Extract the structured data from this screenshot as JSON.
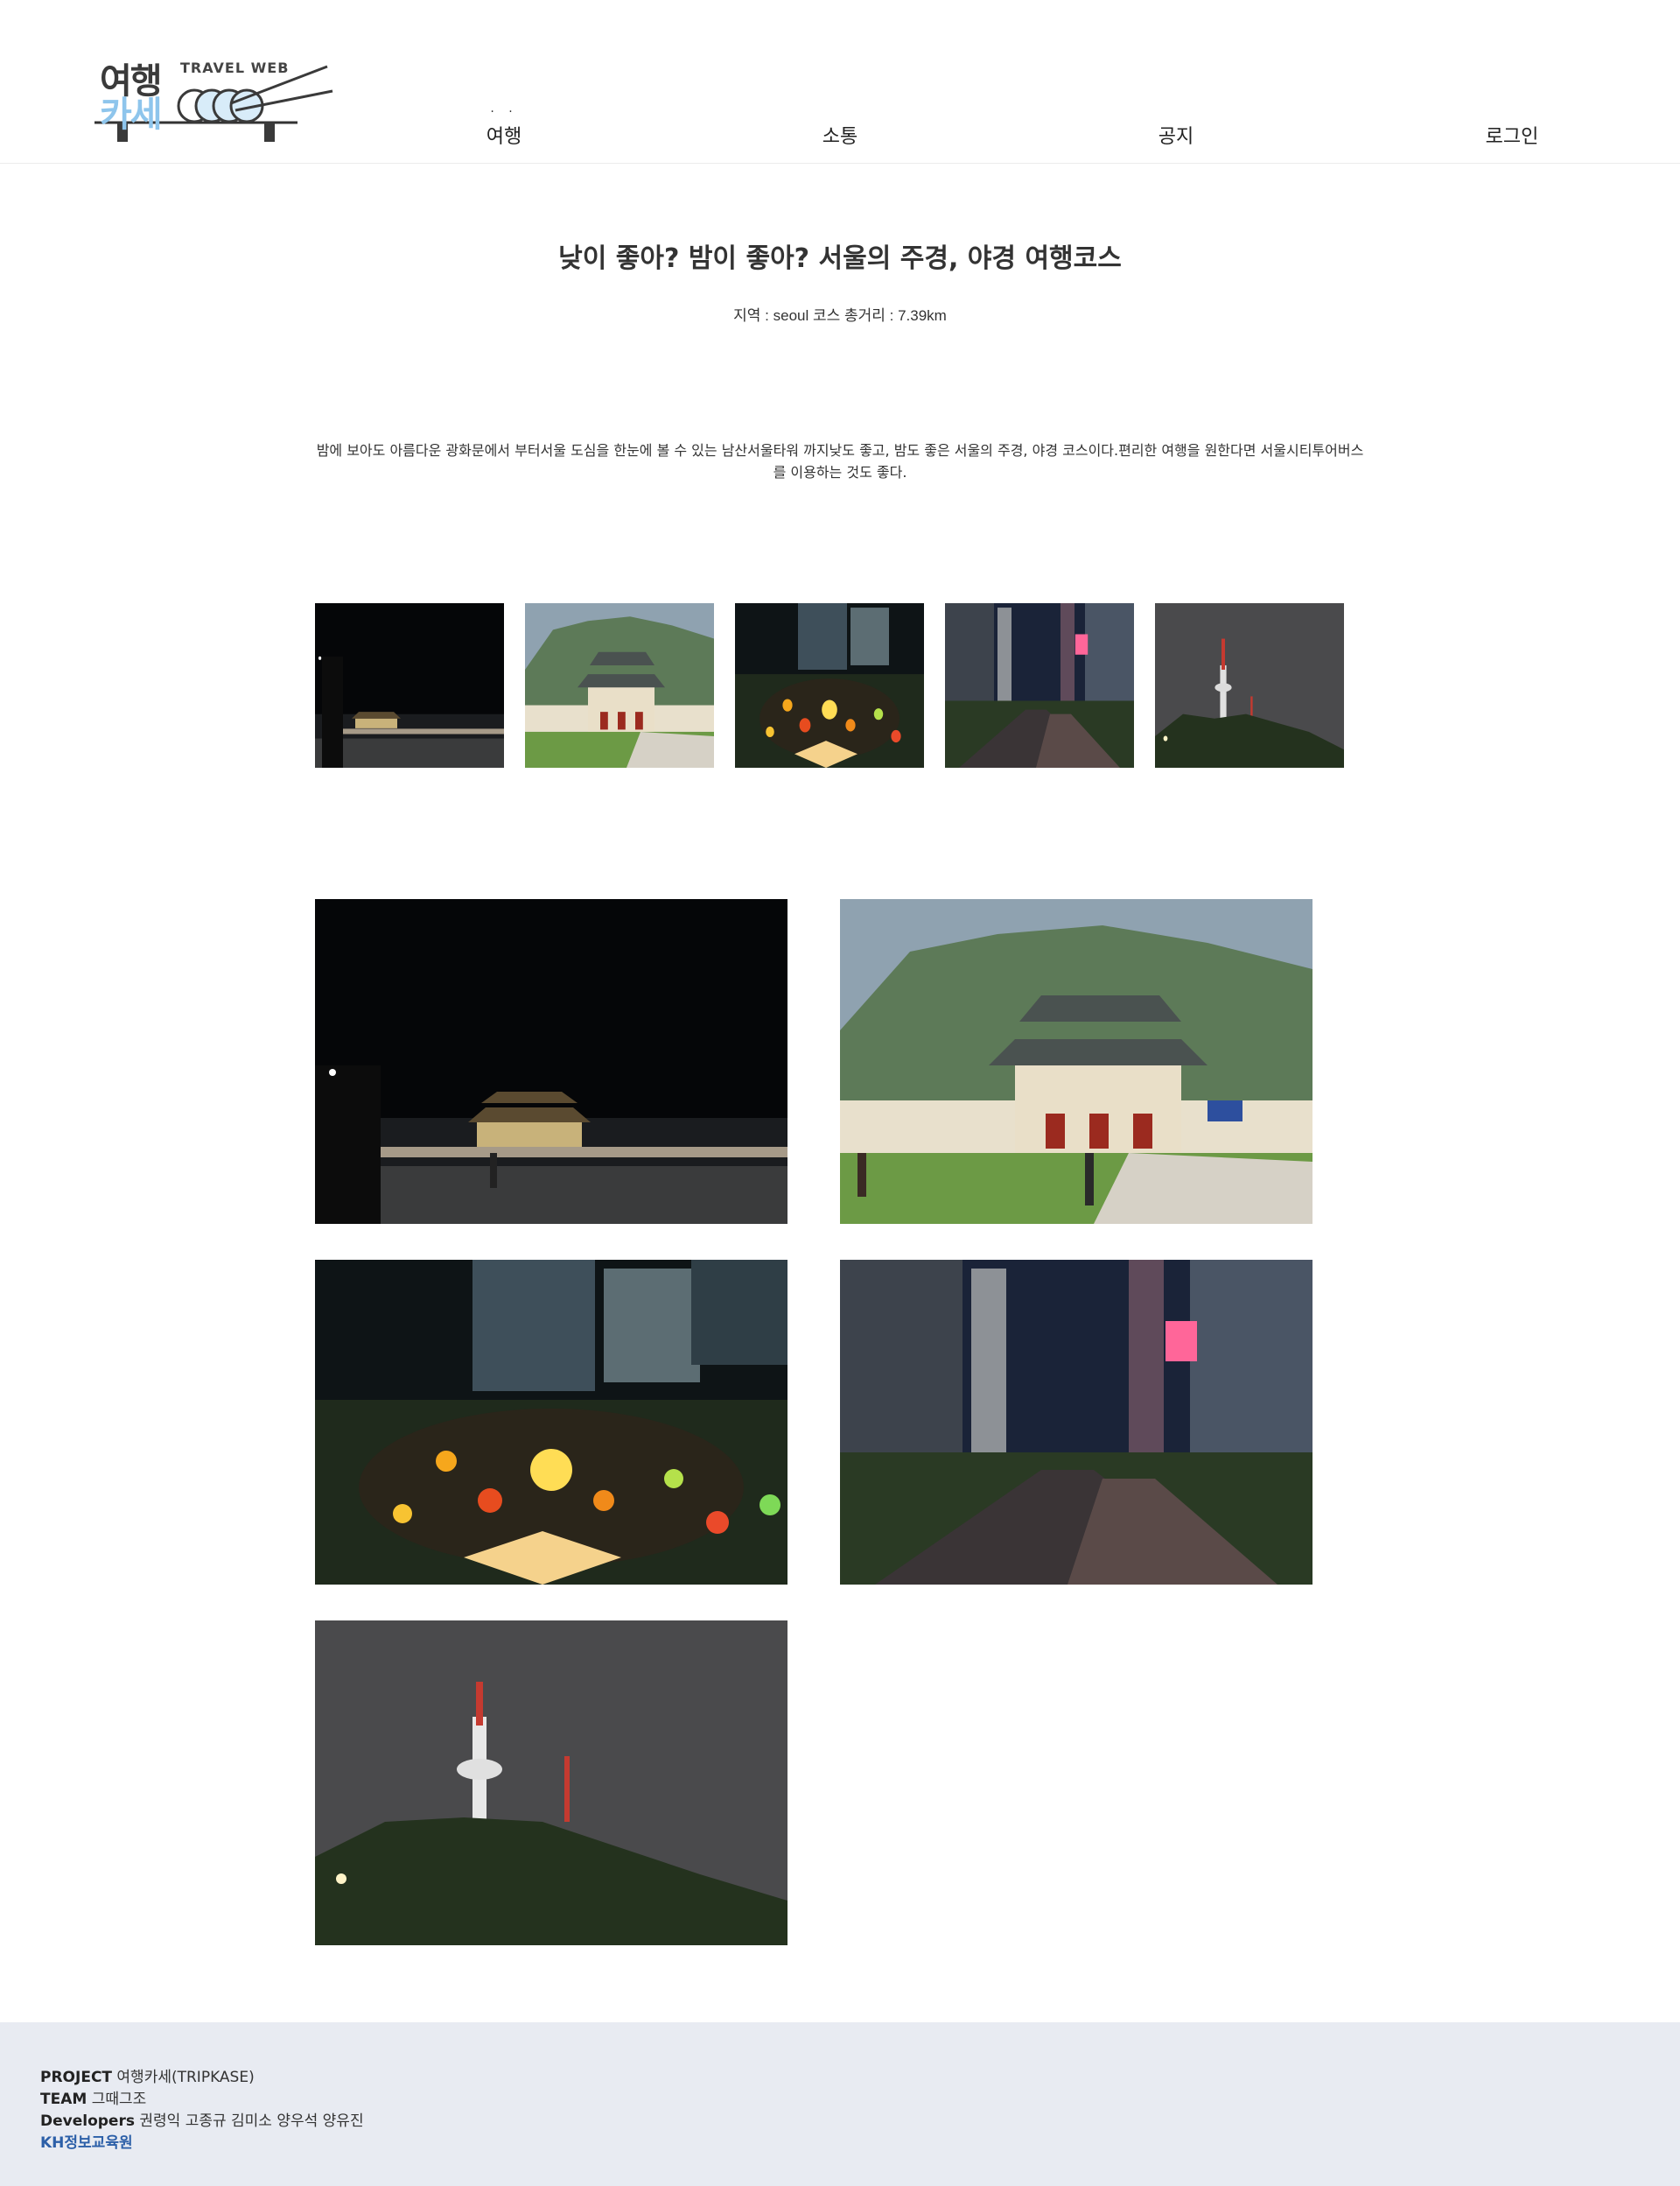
{
  "logo": {
    "line1": "여행",
    "line2": "카세",
    "tagline": "TRAVEL WEB"
  },
  "nav": {
    "items": [
      {
        "label": "여행",
        "active": true
      },
      {
        "label": "소통"
      },
      {
        "label": "공지"
      },
      {
        "label": "로그인"
      }
    ],
    "active_marker": "· ·"
  },
  "course": {
    "title": "낮이 좋아? 밤이 좋아? 서울의 주경, 야경 여행코스",
    "meta": "지역 : seoul 코스 총거리 : 7.39km",
    "description": "밤에 보아도 아름다운 광화문에서 부터서울 도심을 한눈에 볼 수 있는 남산서울타워 까지낮도 좋고, 밤도 좋은 서울의 주경, 야경 코스이다.편리한 여행을 원한다면 서울시티투어버스를 이용하는 것도 좋다."
  },
  "images": [
    {
      "name": "gwanghwamun-night"
    },
    {
      "name": "gwanghwamun-day"
    },
    {
      "name": "cheonggyecheon-lanterns"
    },
    {
      "name": "cheonggyecheon-night-stream"
    },
    {
      "name": "namsan-tower-night"
    }
  ],
  "footer": {
    "project_label": "PROJECT",
    "project_value": "여행카세(TRIPKASE)",
    "team_label": "TEAM",
    "team_value": "그때그조",
    "developers_label": "Developers",
    "developers_value": "권령익 고종규 김미소 양우석 양유진",
    "org": "KH정보교육원"
  }
}
